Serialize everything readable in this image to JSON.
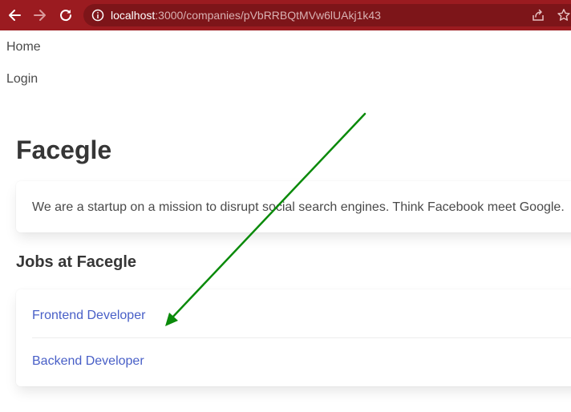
{
  "browser": {
    "url_host": "localhost",
    "url_path": ":3000/companies/pVbRRBQtMVw6lUAkj1k43",
    "toolbar_color": "#9b1b20",
    "icons": [
      "back-arrow-icon",
      "forward-arrow-icon",
      "reload-icon",
      "info-icon",
      "share-icon",
      "star-icon"
    ]
  },
  "nav": {
    "home_label": "Home",
    "login_label": "Login"
  },
  "company": {
    "name": "Facegle",
    "description": "We are a startup on a mission to disrupt social search engines. Think Facebook meet Google."
  },
  "jobs": {
    "heading": "Jobs at Facegle",
    "items": [
      {
        "title": "Frontend Developer"
      },
      {
        "title": "Backend Developer"
      }
    ]
  },
  "annotation": {
    "arrow_color": "#0a8a0a"
  },
  "colors": {
    "link": "#485fc7",
    "title": "#363636",
    "text": "#4a4a4a"
  }
}
